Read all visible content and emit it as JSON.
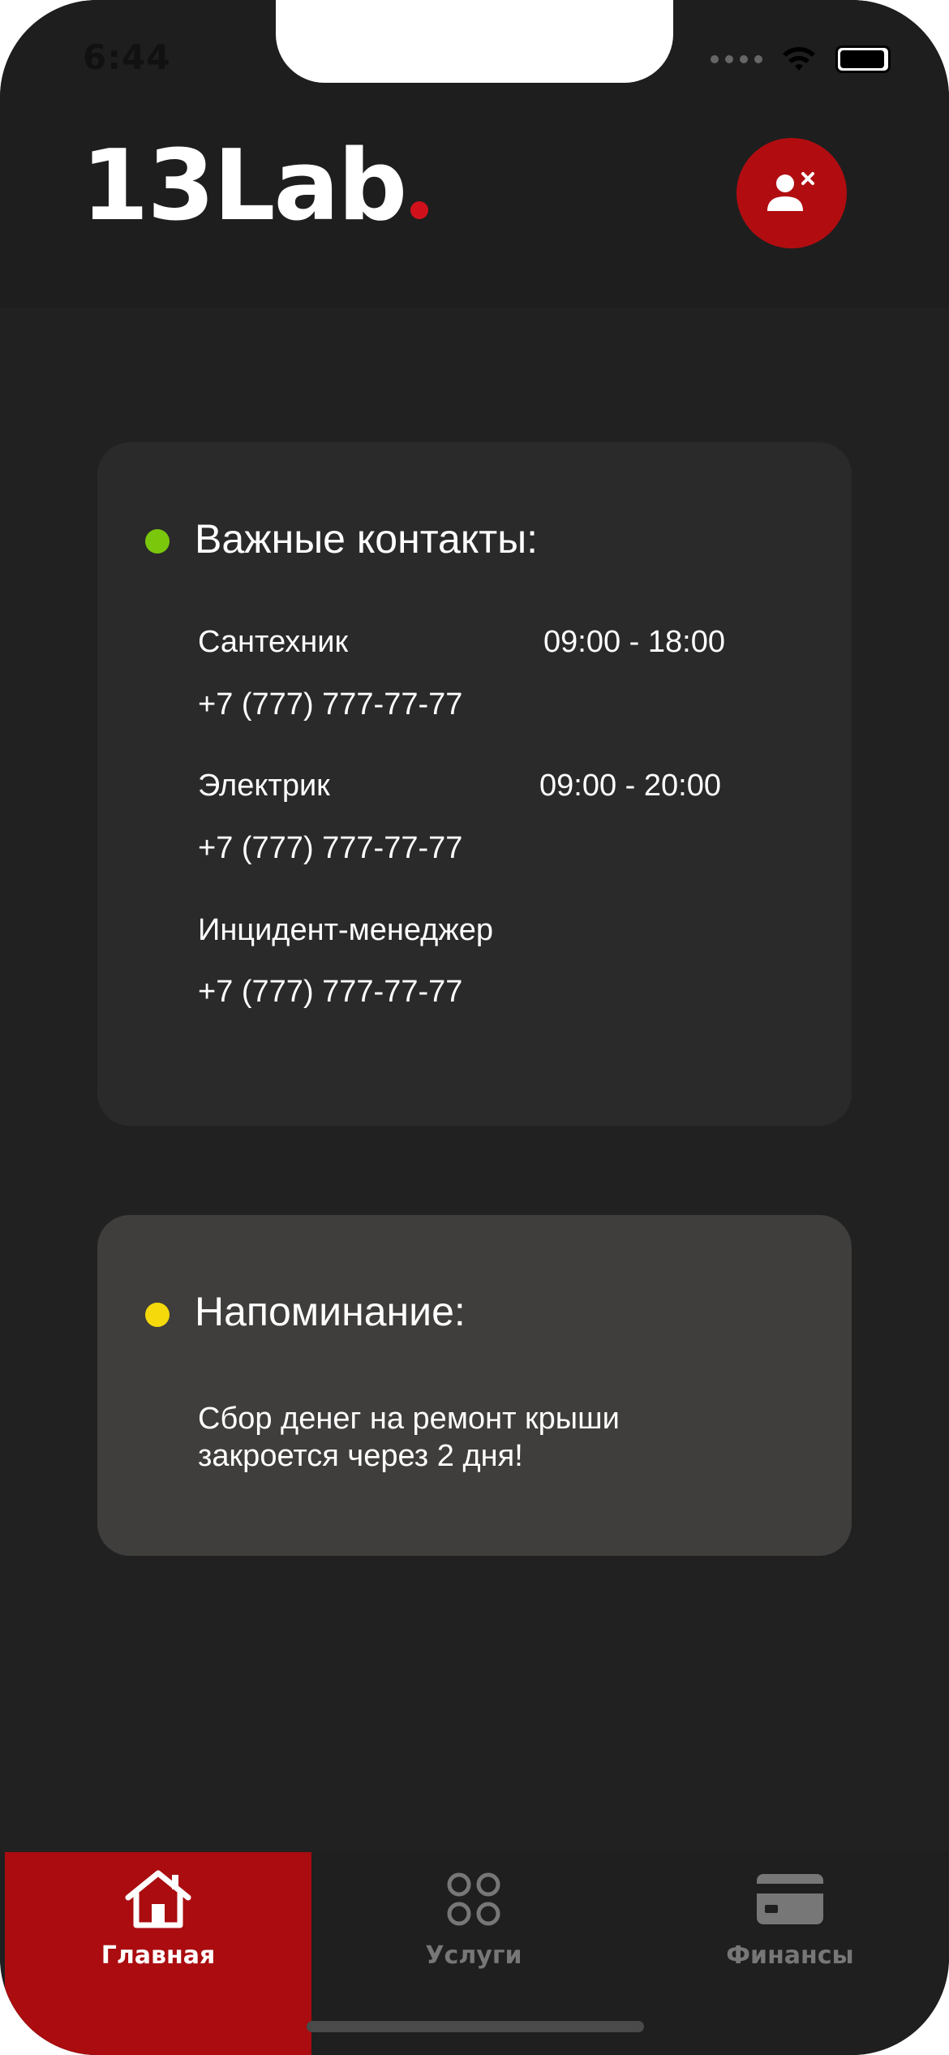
{
  "status_bar": {
    "time": "6:44"
  },
  "header": {
    "logo_text": "13Lab",
    "colors": {
      "accent": "#d0111b",
      "button": "#b10d11"
    },
    "logout_icon": "user-remove-icon"
  },
  "contacts_card": {
    "title": "Важные контакты:",
    "dot_color": "#7ac70c",
    "items": [
      {
        "name": "Сантехник",
        "hours": "09:00 - 18:00",
        "phone": "+7 (777) 777-77-77"
      },
      {
        "name": "Электрик",
        "hours": "09:00 - 20:00",
        "phone": "+7 (777) 777-77-77"
      },
      {
        "name": "Инцидент-менеджер",
        "hours": "",
        "phone": "+7 (777) 777-77-77"
      }
    ]
  },
  "reminder_card": {
    "title": "Напоминание:",
    "dot_color": "#f5d90a",
    "text": "Сбор денег на ремонт крыши закроется через 2 дня!"
  },
  "tabbar": {
    "tabs": [
      {
        "label": "Главная",
        "icon": "home-icon",
        "active": true
      },
      {
        "label": "Услуги",
        "icon": "grid-icon",
        "active": false
      },
      {
        "label": "Финансы",
        "icon": "card-icon",
        "active": false
      }
    ],
    "active_color": "#aa0c10"
  }
}
